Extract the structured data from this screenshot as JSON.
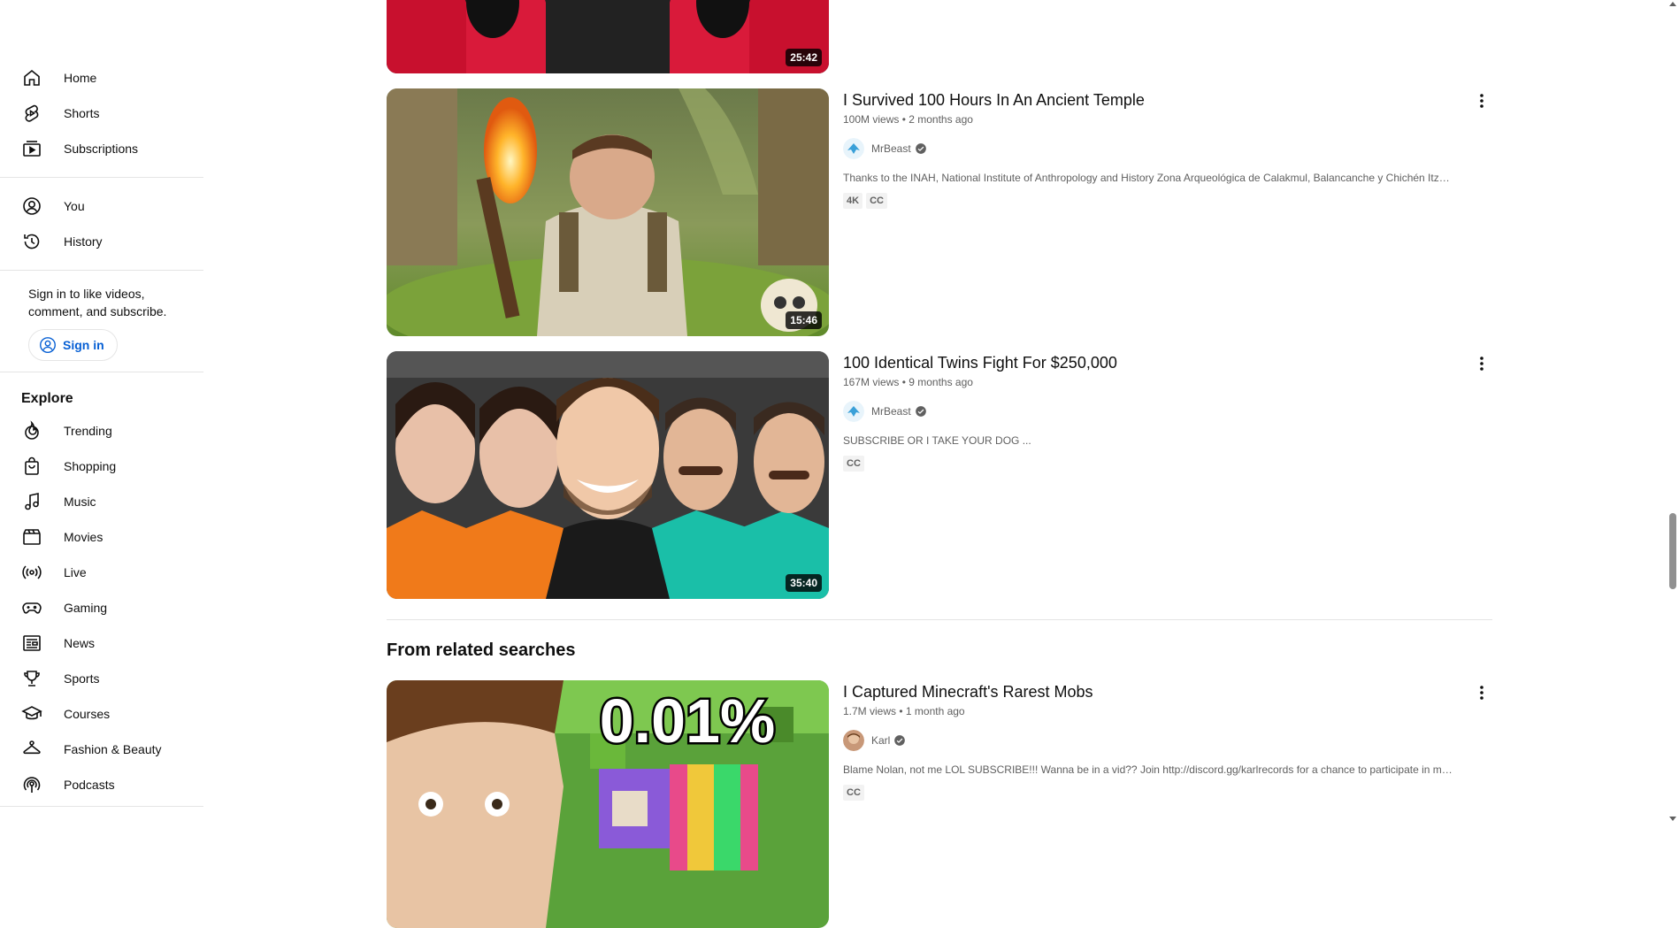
{
  "sidebar": {
    "main_items": [
      {
        "label": "Home",
        "icon": "home-icon"
      },
      {
        "label": "Shorts",
        "icon": "shorts-icon"
      },
      {
        "label": "Subscriptions",
        "icon": "subscriptions-icon"
      }
    ],
    "you_items": [
      {
        "label": "You",
        "icon": "account-icon"
      },
      {
        "label": "History",
        "icon": "history-icon"
      }
    ],
    "signin_text": "Sign in to like videos, comment, and subscribe.",
    "signin_button": "Sign in",
    "explore_title": "Explore",
    "explore_items": [
      {
        "label": "Trending",
        "icon": "trending-icon"
      },
      {
        "label": "Shopping",
        "icon": "shopping-bag-icon"
      },
      {
        "label": "Music",
        "icon": "music-note-icon"
      },
      {
        "label": "Movies",
        "icon": "clapperboard-icon"
      },
      {
        "label": "Live",
        "icon": "live-broadcast-icon"
      },
      {
        "label": "Gaming",
        "icon": "gamepad-icon"
      },
      {
        "label": "News",
        "icon": "newspaper-icon"
      },
      {
        "label": "Sports",
        "icon": "trophy-icon"
      },
      {
        "label": "Courses",
        "icon": "graduation-cap-icon"
      },
      {
        "label": "Fashion & Beauty",
        "icon": "hanger-icon"
      },
      {
        "label": "Podcasts",
        "icon": "podcast-icon"
      }
    ]
  },
  "results": {
    "partial_top": {
      "duration": "25:42"
    },
    "videos": [
      {
        "title": "I Survived 100 Hours In An Ancient Temple",
        "meta": "100M views • 2 months ago",
        "channel": "MrBeast",
        "description": "Thanks to the INAH, National Institute of Anthropology and History Zona Arqueológica de Calakmul, Balancanche y Chichén Itzá ...",
        "badges": [
          "4K",
          "CC"
        ],
        "duration": "15:46"
      },
      {
        "title": "100 Identical Twins Fight For $250,000",
        "meta": "167M views • 9 months ago",
        "channel": "MrBeast",
        "description": "SUBSCRIBE OR I TAKE YOUR DOG ...",
        "badges": [
          "CC"
        ],
        "duration": "35:40"
      }
    ],
    "related_title": "From related searches",
    "related": [
      {
        "title": "I Captured Minecraft's Rarest Mobs",
        "meta": "1.7M views • 1 month ago",
        "channel": "Karl",
        "description": "Blame Nolan, not me LOL SUBSCRIBE!!! Wanna be in a vid?? Join http://discord.gg/karlrecords for a chance to participate in my ...",
        "badges": [
          "CC"
        ],
        "thumb_text": "0.01%"
      }
    ]
  },
  "colors": {
    "accent_link": "#065fd4",
    "text_primary": "#0f0f0f",
    "text_secondary": "#606060"
  }
}
